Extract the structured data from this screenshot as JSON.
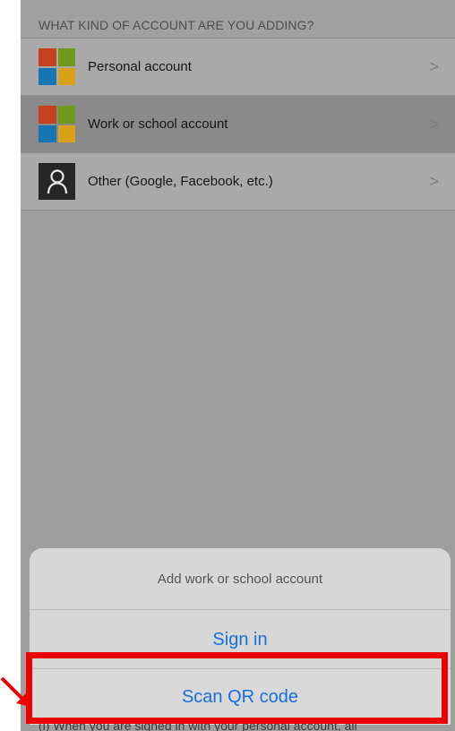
{
  "section_header": "WHAT KIND OF ACCOUNT ARE YOU ADDING?",
  "accounts": [
    {
      "label": "Personal account",
      "icon": "microsoft-logo-icon",
      "highlighted": false
    },
    {
      "label": "Work or school account",
      "icon": "microsoft-logo-icon",
      "highlighted": true
    },
    {
      "label": "Other (Google, Facebook, etc.)",
      "icon": "user-icon",
      "highlighted": false
    }
  ],
  "chevron": ">",
  "sheet": {
    "title": "Add work or school account",
    "sign_in": "Sign in",
    "scan_qr": "Scan QR code"
  },
  "footnote": "(i)  When you are signed in with your personal account, all",
  "colors": {
    "accent": "#1a6fd8",
    "highlight_box": "#ec0000",
    "ms_red": "#c4421f",
    "ms_green": "#6f9b1b",
    "ms_blue": "#1675b4",
    "ms_yellow": "#d9a11a"
  }
}
